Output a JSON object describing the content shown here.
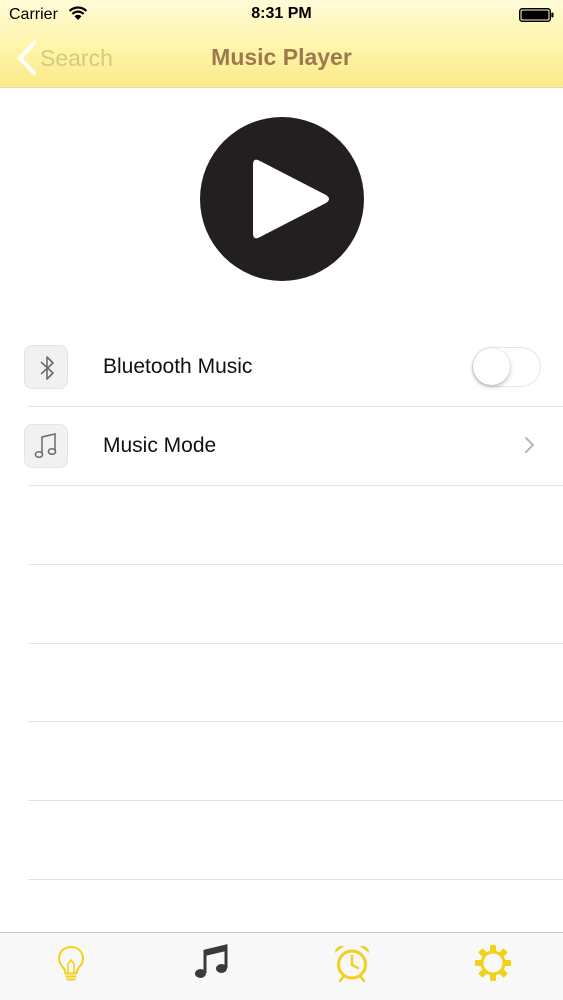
{
  "status_bar": {
    "carrier": "Carrier",
    "time": "8:31 PM",
    "wifi_icon": "wifi-icon",
    "battery_icon": "battery-icon"
  },
  "nav": {
    "back_label": "Search",
    "back_icon": "chevron-left-icon",
    "title": "Music Player"
  },
  "player": {
    "play_icon": "play-icon"
  },
  "settings": {
    "bluetooth": {
      "label": "Bluetooth Music",
      "icon": "bluetooth-icon",
      "toggle_on": false
    },
    "music_mode": {
      "label": "Music Mode",
      "icon": "music-note-icon",
      "accessory_icon": "chevron-right-icon"
    }
  },
  "tabbar": {
    "tabs": [
      {
        "icon": "lightbulb-icon",
        "selected": false
      },
      {
        "icon": "music-note-icon",
        "selected": true
      },
      {
        "icon": "alarm-clock-icon",
        "selected": false
      },
      {
        "icon": "gear-icon",
        "selected": false
      }
    ]
  },
  "colors": {
    "accent_yellow": "#f5d60a",
    "nav_title": "#9a7a4e",
    "back_text": "#d8c87c",
    "play_button": "#231f20",
    "selected_tab": "#3a3a3a"
  }
}
